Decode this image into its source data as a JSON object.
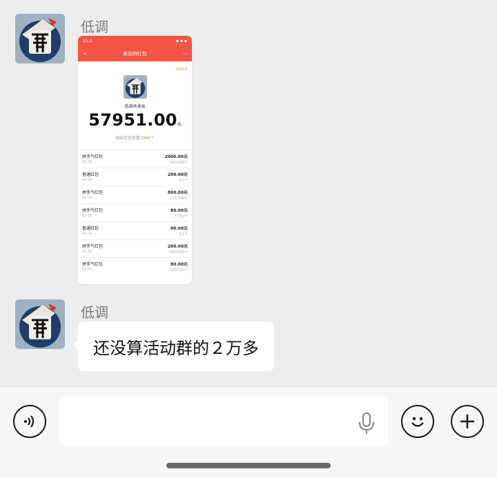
{
  "messages": [
    {
      "sender": "低调",
      "type": "image"
    },
    {
      "sender": "低调",
      "type": "text",
      "text": "还没算活动群的２万多"
    }
  ],
  "screenshot": {
    "status_time": "11:2",
    "nav_back": "<",
    "nav_title": "发出的红包",
    "nav_more": "···",
    "year": "2026年",
    "summary_label": "低调共发出",
    "total_amount": "57951.00",
    "total_unit": "元",
    "count_prefix": "发出红包总数",
    "count_value": "3966",
    "count_unit": "个",
    "rows": [
      {
        "name": "拼手气红包",
        "date": "02-16",
        "amount": "2000.00元",
        "progress": "160/160个"
      },
      {
        "name": "普通红包",
        "date": "02-16",
        "amount": "200.00元",
        "progress": "0/1个"
      },
      {
        "name": "拼手气红包",
        "date": "02-16",
        "amount": "800.00元",
        "progress": "117/146个"
      },
      {
        "name": "拼手气红包",
        "date": "02-16",
        "amount": "80.00元",
        "progress": "77/80个"
      },
      {
        "name": "普通红包",
        "date": "02-16",
        "amount": "80.00元",
        "progress": "1/1个"
      },
      {
        "name": "拼手气红包",
        "date": "02-16",
        "amount": "200.00元",
        "progress": "160/160个"
      },
      {
        "name": "拼手气红包",
        "date": "02-16",
        "amount": "80.00元",
        "progress": "120/120个"
      }
    ]
  },
  "input_bar": {
    "voice_icon": "voice-toggle-icon",
    "mic_icon": "microphone-icon",
    "emoji_icon": "emoji-icon",
    "plus_icon": "plus-icon"
  },
  "colors": {
    "accent_red": "#f25544",
    "gold": "#c59a50",
    "bg": "#ededed"
  }
}
